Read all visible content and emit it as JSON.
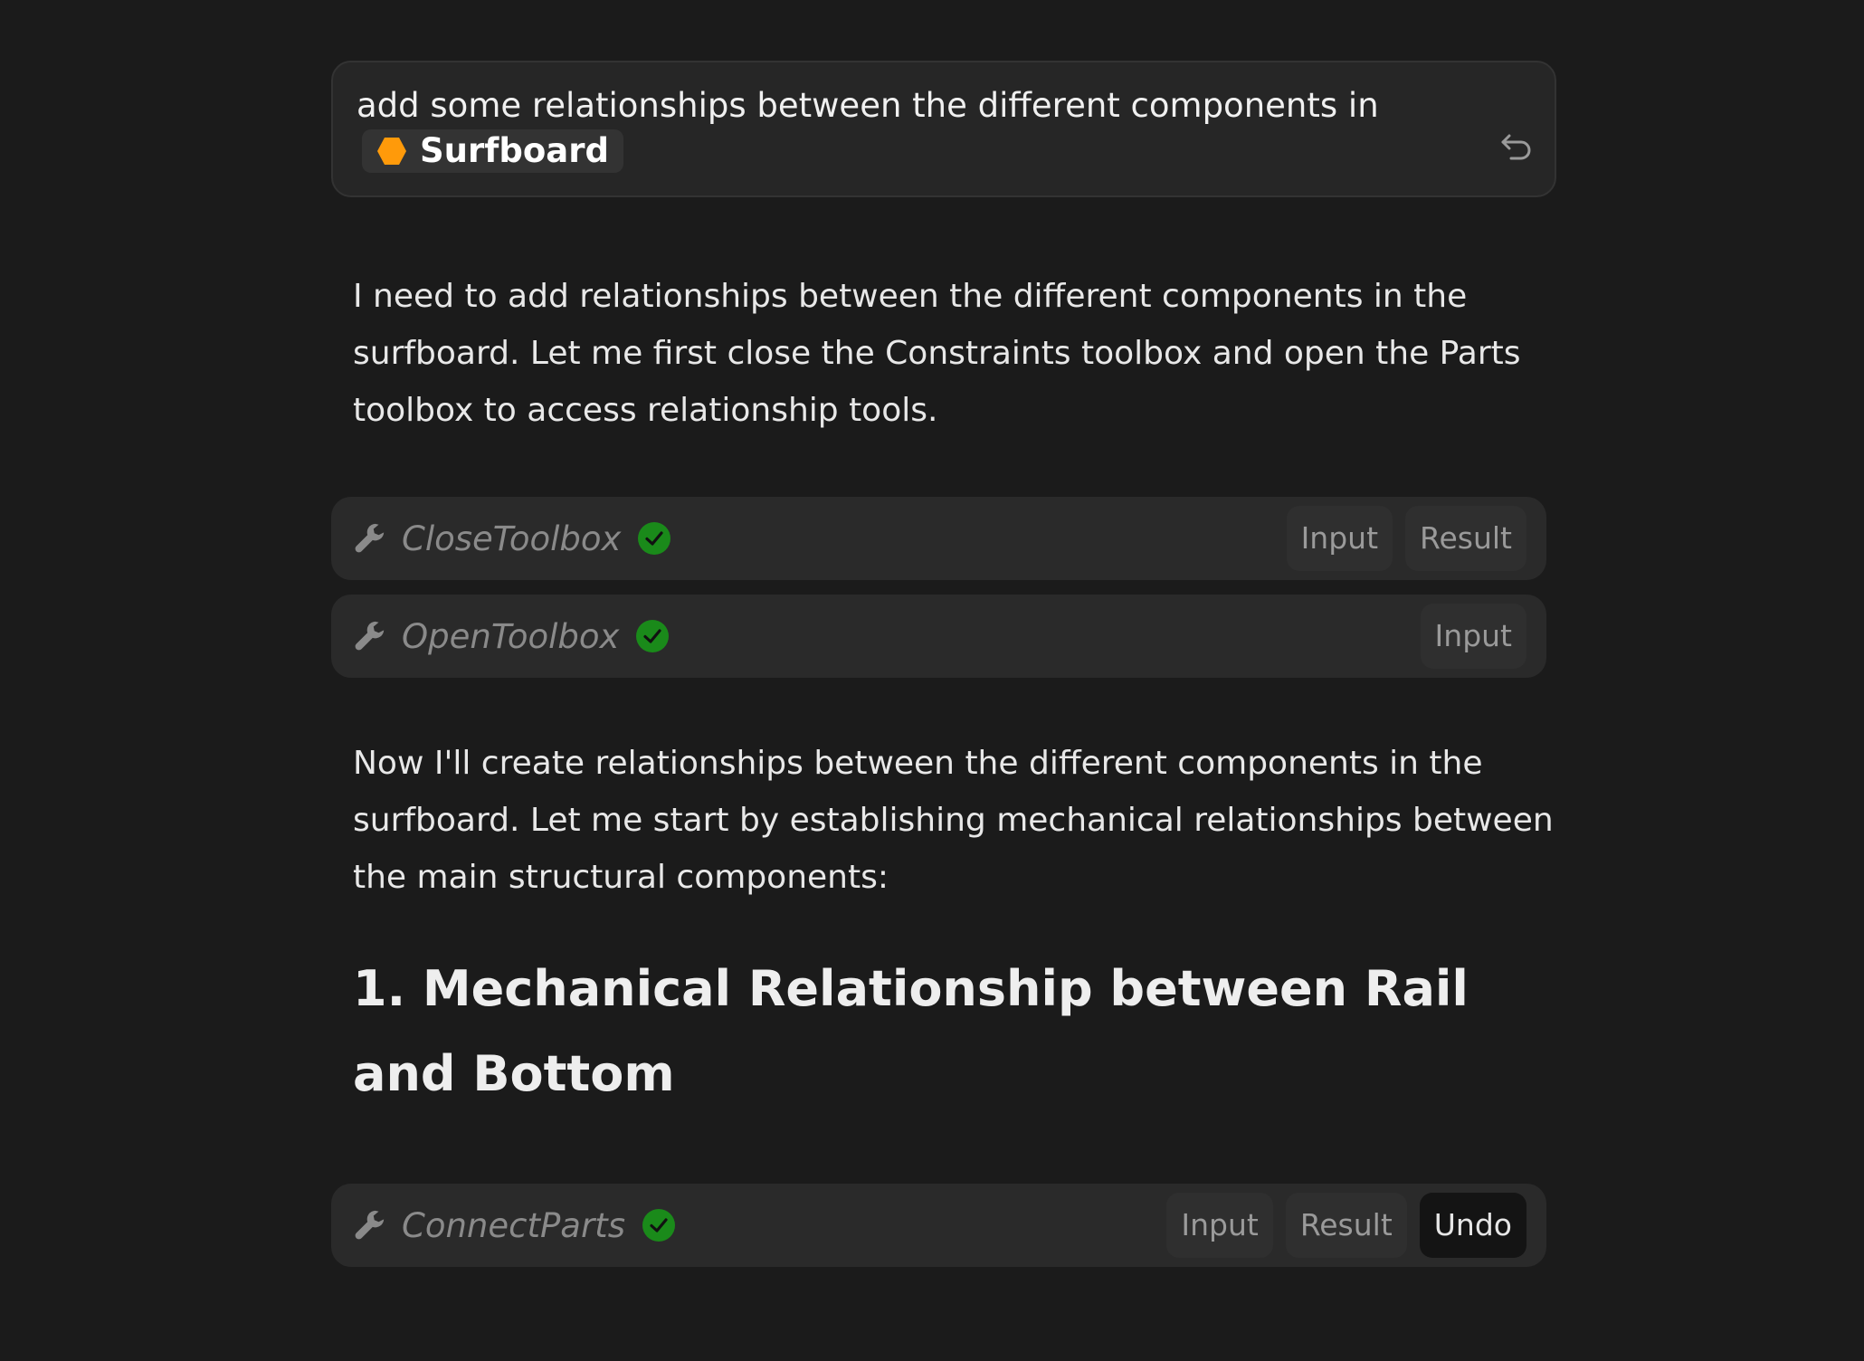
{
  "prompt": {
    "text": "add some relationships between the different components in",
    "chip_label": "Surfboard",
    "chip_icon": "orange-hexagon-icon",
    "chip_color": "#ff9a0a",
    "undo_icon": "undo-arrow-icon"
  },
  "messages": [
    {
      "type": "paragraph",
      "text": "I need to add relationships between the different components in the surfboard. Let me first close the Constraints toolbox and open the Parts toolbox to access relationship tools."
    },
    {
      "type": "paragraph",
      "text": "Now I'll create relationships between the different components in the surfboard. Let me start by establishing mechanical relationships between the main structural components:"
    },
    {
      "type": "heading",
      "text": "1. Mechanical Relationship between Rail and Bottom"
    }
  ],
  "tools": [
    {
      "name": "CloseToolbox",
      "status": "success",
      "status_color": "#1a8a1a",
      "icon": "wrench-icon",
      "buttons": [
        "Input",
        "Result"
      ]
    },
    {
      "name": "OpenToolbox",
      "status": "success",
      "status_color": "#1a8a1a",
      "icon": "wrench-icon",
      "buttons": [
        "Input"
      ]
    },
    {
      "name": "ConnectParts",
      "status": "success",
      "status_color": "#1a8a1a",
      "icon": "wrench-icon",
      "buttons": [
        "Input",
        "Result",
        "Undo"
      ]
    }
  ]
}
